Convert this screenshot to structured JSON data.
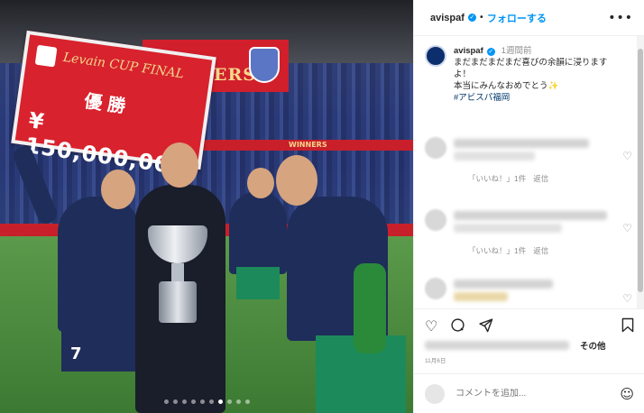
{
  "photo": {
    "board_cup": "Levain CUP FINAL",
    "board_title": "優勝",
    "board_amount": "¥ 150,000,000",
    "banner": "WINNERS",
    "ribbon": "WINNERS",
    "jersey_number": "7",
    "carousel_count": 10,
    "carousel_active": 6
  },
  "header": {
    "username": "avispaf",
    "separator": "•",
    "follow_label": "フォローする",
    "more_icon": "more-horizontal-icon"
  },
  "caption": {
    "username": "avispaf",
    "time": "1週間前",
    "line1": "まだまだまだまだ喜びの余韻に浸ります",
    "line2": "よ！",
    "line3": "本当にみんなおめでとう✨",
    "hashtag": "#アビスパ福岡"
  },
  "comments": [
    {
      "likes_label": "「いいね！」1件",
      "reply_label": "返信"
    },
    {
      "likes_label": "「いいね！」1件",
      "reply_label": "返信"
    },
    {
      "likes_label": "",
      "reply_label": ""
    }
  ],
  "post": {
    "others_label": "その他",
    "date": "11月6日",
    "comment_placeholder": "コメントを追加..."
  },
  "colors": {
    "accent": "#0095f6",
    "hashtag": "#00376b",
    "muted": "#8e8e8e"
  }
}
